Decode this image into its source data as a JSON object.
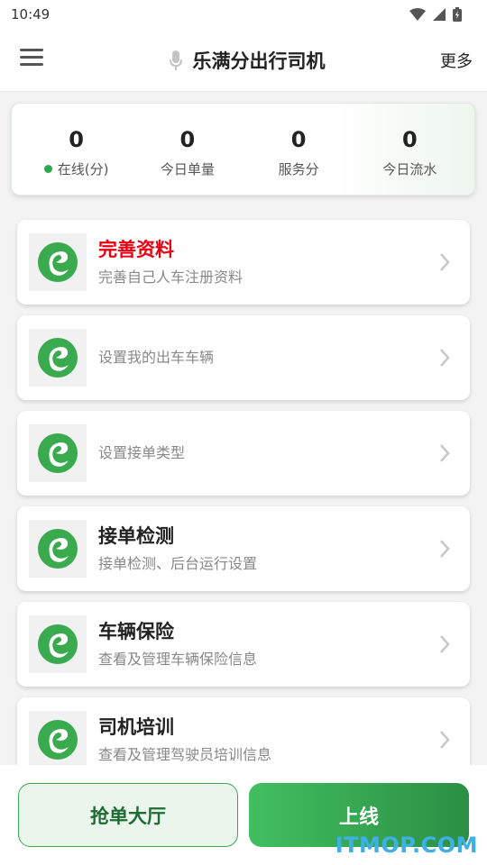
{
  "status_bar": {
    "time": "10:49"
  },
  "app_bar": {
    "title": "乐满分出行司机",
    "more": "更多"
  },
  "stats": [
    {
      "value": "0",
      "label": "在线(分)"
    },
    {
      "value": "0",
      "label": "今日单量"
    },
    {
      "value": "0",
      "label": "服务分"
    },
    {
      "value": "0",
      "label": "今日流水"
    }
  ],
  "colors": {
    "accent": "#2ea84f",
    "alert": "#e60012",
    "watermark": "#3fb0e6"
  },
  "items": [
    {
      "title": "完善资料",
      "subtitle": "完善自己人车注册资料",
      "icon": "brand-logo-icon"
    },
    {
      "title": "",
      "subtitle": "设置我的出车车辆",
      "icon": "brand-logo-icon"
    },
    {
      "title": "",
      "subtitle": "设置接单类型",
      "icon": "brand-logo-icon"
    },
    {
      "title": "接单检测",
      "subtitle": "接单检测、后台运行设置",
      "icon": "brand-logo-icon"
    },
    {
      "title": "车辆保险",
      "subtitle": "查看及管理车辆保险信息",
      "icon": "brand-logo-icon"
    },
    {
      "title": "司机培训",
      "subtitle": "查看及管理驾驶员培训信息",
      "icon": "brand-logo-icon"
    }
  ],
  "bottom": {
    "hall": "抢单大厅",
    "online": "上线"
  },
  "watermark": "ITMOP.COM"
}
